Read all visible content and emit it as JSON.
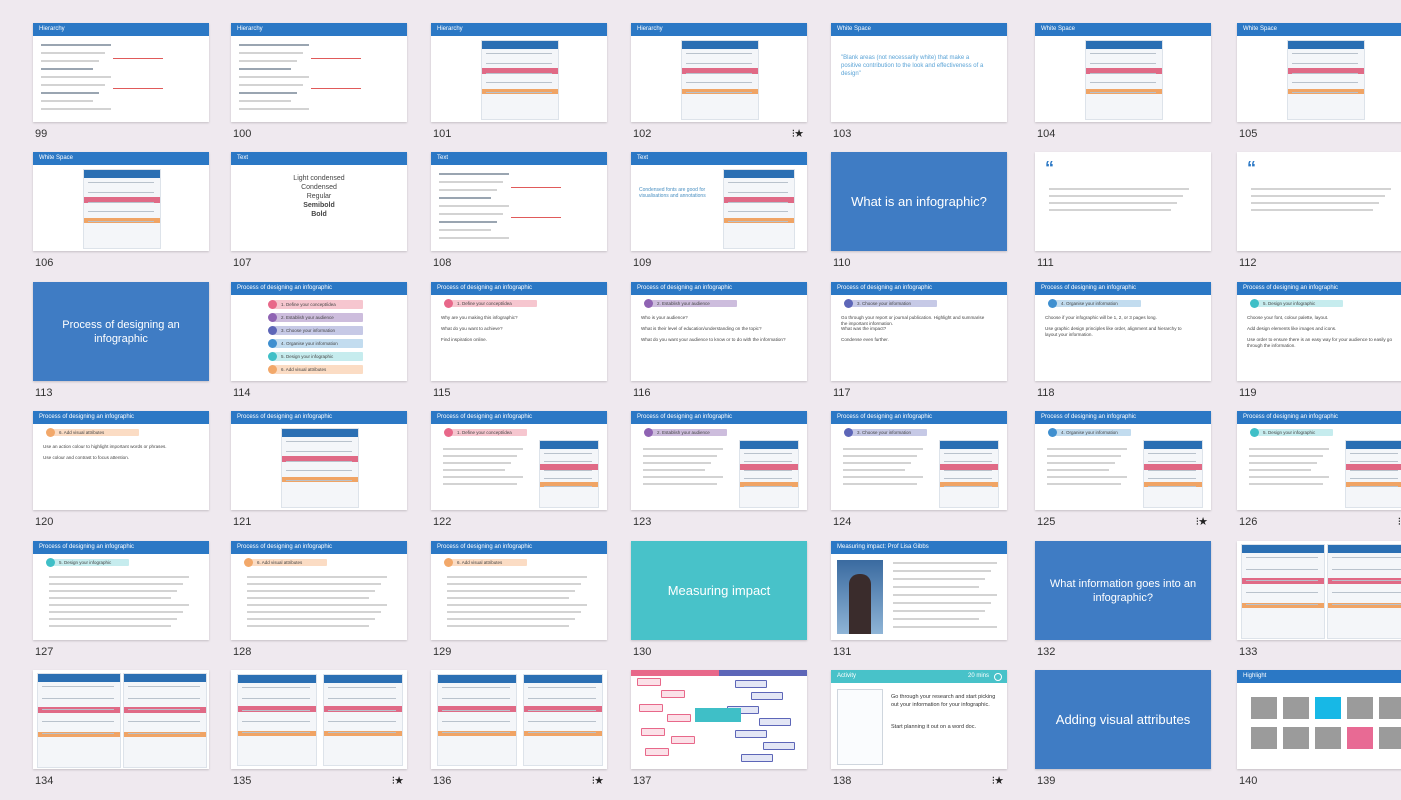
{
  "slides": [
    {
      "num": "99",
      "title": "Hierarchy",
      "kind": "lines",
      "starred": false
    },
    {
      "num": "100",
      "title": "Hierarchy",
      "kind": "lines",
      "starred": false
    },
    {
      "num": "101",
      "title": "Hierarchy",
      "kind": "poster",
      "starred": false
    },
    {
      "num": "102",
      "title": "Hierarchy",
      "kind": "poster",
      "starred": true
    },
    {
      "num": "103",
      "title": "White Space",
      "kind": "quote-text",
      "text": "\"Blank areas (not necessarily white) that make a positive contribution to the look and effectiveness of a design\"",
      "starred": false
    },
    {
      "num": "104",
      "title": "White Space",
      "kind": "poster",
      "starred": false
    },
    {
      "num": "105",
      "title": "White Space",
      "kind": "poster",
      "starred": false
    },
    {
      "num": "106",
      "title": "White Space",
      "kind": "poster",
      "starred": false
    },
    {
      "num": "107",
      "title": "Text",
      "kind": "fonts",
      "fonts": [
        "Light condensed",
        "Condensed",
        "Regular",
        "Semibold",
        "Bold"
      ],
      "starred": false
    },
    {
      "num": "108",
      "title": "Text",
      "kind": "lines",
      "starred": false
    },
    {
      "num": "109",
      "title": "Text",
      "kind": "poster",
      "text": "Condensed fonts are good for visualisations and annotations",
      "starred": false
    },
    {
      "num": "110",
      "title": "",
      "kind": "solid",
      "text": "What is an infographic?",
      "starred": false
    },
    {
      "num": "111",
      "title": "",
      "kind": "quote",
      "starred": false
    },
    {
      "num": "112",
      "title": "",
      "kind": "quote",
      "starred": false
    },
    {
      "num": "113",
      "title": "",
      "kind": "solid",
      "text": "Process of designing an infographic",
      "starred": false
    },
    {
      "num": "114",
      "title": "Process of designing an infographic",
      "kind": "steps",
      "steps": [
        "1. Define your concept/idea",
        "2. Establish your audience",
        "3. Choose your information",
        "4. Organise your information",
        "5. Design your infographic",
        "6. Add visual attributes"
      ],
      "starred": false
    },
    {
      "num": "115",
      "title": "Process of designing an infographic",
      "kind": "step-bullets",
      "step": "1. Define your concept/idea",
      "stepColor": "#f6c6cf",
      "dotColor": "#e8688a",
      "bullets": [
        "Why are you making this infographic?",
        "What do you want to achieve?",
        "Find inspiration online."
      ],
      "starred": false
    },
    {
      "num": "116",
      "title": "Process of designing an infographic",
      "kind": "step-bullets",
      "step": "2. Establish your audience",
      "stepColor": "#cdbddd",
      "dotColor": "#8f63b3",
      "bullets": [
        "Who is your audience?",
        "What is their level of education/understanding on the topic?",
        "What do you want your audience to know or to do with the information?"
      ],
      "starred": false
    },
    {
      "num": "117",
      "title": "Process of designing an infographic",
      "kind": "step-bullets",
      "step": "3. Choose your information",
      "stepColor": "#c6c9e6",
      "dotColor": "#5d66b8",
      "bullets": [
        "Go through your report or journal publication. Highlight and summarise the important information.",
        "What was the impact?",
        "Condense even further."
      ],
      "starred": false
    },
    {
      "num": "118",
      "title": "Process of designing an infographic",
      "kind": "step-bullets",
      "step": "4. Organise your information",
      "stepColor": "#c2dcef",
      "dotColor": "#3f8fcf",
      "bullets": [
        "Choose if your infographic will be 1, 2, or 3 pages long.",
        "Use graphic design principles like order, alignment and hierarchy to layout your information."
      ],
      "starred": false
    },
    {
      "num": "119",
      "title": "Process of designing an infographic",
      "kind": "step-bullets",
      "step": "5. Design your infographic",
      "stepColor": "#c6ecee",
      "dotColor": "#3fbfc7",
      "bullets": [
        "Choose your font, colour palette, layout.",
        "Add design elements like images and icons.",
        "Use order to ensure there is an easy way for your audience to easily go through the information."
      ],
      "starred": false
    },
    {
      "num": "120",
      "title": "Process of designing an infographic",
      "kind": "step-bullets",
      "step": "6. Add visual attributes",
      "stepColor": "#fbdcc4",
      "dotColor": "#f2a86a",
      "bullets": [
        "Use an action colour to highlight important words or phrases.",
        "Use colour and contrast to focus attention."
      ],
      "starred": false
    },
    {
      "num": "121",
      "title": "Process of designing an infographic",
      "kind": "poster",
      "starred": false
    },
    {
      "num": "122",
      "title": "Process of designing an infographic",
      "kind": "step-poster",
      "step": "1. Define your concept/idea",
      "stepColor": "#f6c6cf",
      "dotColor": "#e8688a",
      "starred": false
    },
    {
      "num": "123",
      "title": "Process of designing an infographic",
      "kind": "step-poster",
      "step": "2. Establish your audience",
      "stepColor": "#cdbddd",
      "dotColor": "#8f63b3",
      "starred": false
    },
    {
      "num": "124",
      "title": "Process of designing an infographic",
      "kind": "step-poster",
      "step": "3. Choose your information",
      "stepColor": "#c6c9e6",
      "dotColor": "#5d66b8",
      "starred": false
    },
    {
      "num": "125",
      "title": "Process of designing an infographic",
      "kind": "step-poster",
      "step": "4. Organise your information",
      "stepColor": "#c2dcef",
      "dotColor": "#3f8fcf",
      "starred": true
    },
    {
      "num": "126",
      "title": "Process of designing an infographic",
      "kind": "step-poster",
      "step": "5. Design your infographic",
      "stepColor": "#c6ecee",
      "dotColor": "#3fbfc7",
      "starred": true
    },
    {
      "num": "127",
      "title": "Process of designing an infographic",
      "kind": "step-wide",
      "step": "5. Design your infographic",
      "stepColor": "#c6ecee",
      "dotColor": "#3fbfc7",
      "starred": false
    },
    {
      "num": "128",
      "title": "Process of designing an infographic",
      "kind": "step-wide",
      "step": "6. Add visual attributes",
      "stepColor": "#fbdcc4",
      "dotColor": "#f2a86a",
      "starred": false
    },
    {
      "num": "129",
      "title": "Process of designing an infographic",
      "kind": "step-wide",
      "step": "6. Add visual attributes",
      "stepColor": "#fbdcc4",
      "dotColor": "#f2a86a",
      "starred": false
    },
    {
      "num": "130",
      "title": "",
      "kind": "solid-teal",
      "text": "Measuring impact",
      "starred": false
    },
    {
      "num": "131",
      "title": "Measuring impact: Prof Lisa Gibbs",
      "kind": "photo",
      "starred": false
    },
    {
      "num": "132",
      "title": "",
      "kind": "solid",
      "text": "What information goes into an infographic?",
      "starred": false
    },
    {
      "num": "133",
      "title": "",
      "kind": "poster-full",
      "starred": false
    },
    {
      "num": "134",
      "title": "",
      "kind": "poster-full",
      "starred": false
    },
    {
      "num": "135",
      "title": "",
      "kind": "poster",
      "starred": true
    },
    {
      "num": "136",
      "title": "",
      "kind": "poster",
      "starred": true
    },
    {
      "num": "137",
      "title": "",
      "kind": "tags",
      "starred": false
    },
    {
      "num": "138",
      "title": "Activity",
      "kind": "activity",
      "timer": "20 mins",
      "lines": [
        "Go through your research and start picking out your information for your infographic.",
        "Start planning it out on a word doc."
      ],
      "starred": true
    },
    {
      "num": "139",
      "title": "",
      "kind": "solid",
      "text": "Adding visual attributes",
      "starred": false
    },
    {
      "num": "140",
      "title": "Highlight",
      "kind": "highlight",
      "starred": false
    }
  ],
  "star_glyph": "⁝★"
}
